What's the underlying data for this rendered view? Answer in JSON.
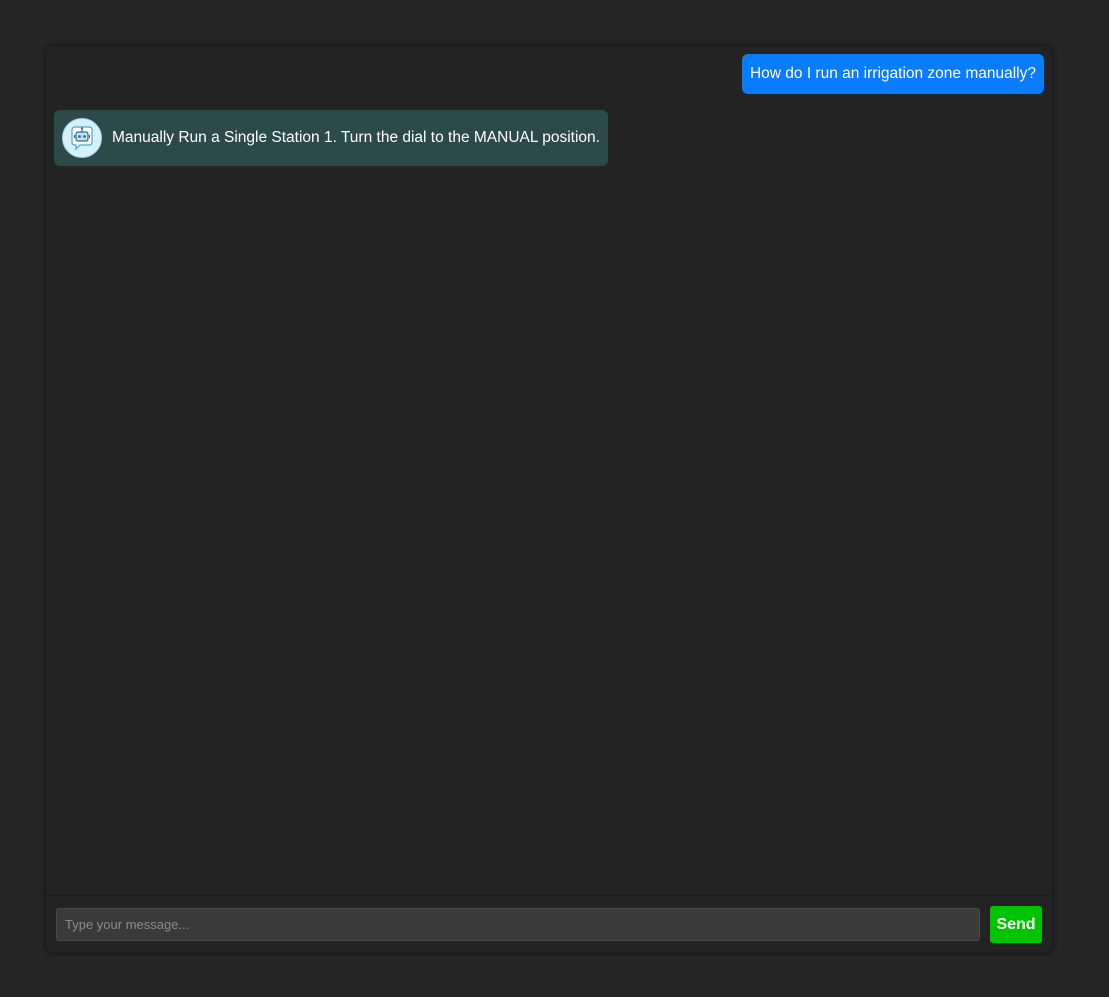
{
  "chat": {
    "messages": [
      {
        "sender": "user",
        "text": "How do I run an irrigation zone manually?"
      },
      {
        "sender": "bot",
        "avatar_icon": "robot-chat-icon",
        "text": "Manually Run a Single Station 1. Turn the dial to the MANUAL position."
      }
    ]
  },
  "composer": {
    "placeholder": "Type your message...",
    "value": "",
    "send_label": "Send"
  },
  "colors": {
    "page_background": "#262626",
    "window_background": "#232323",
    "user_bubble": "#0a7cff",
    "bot_bubble": "#2c4a4a",
    "send_button": "#00c400"
  }
}
